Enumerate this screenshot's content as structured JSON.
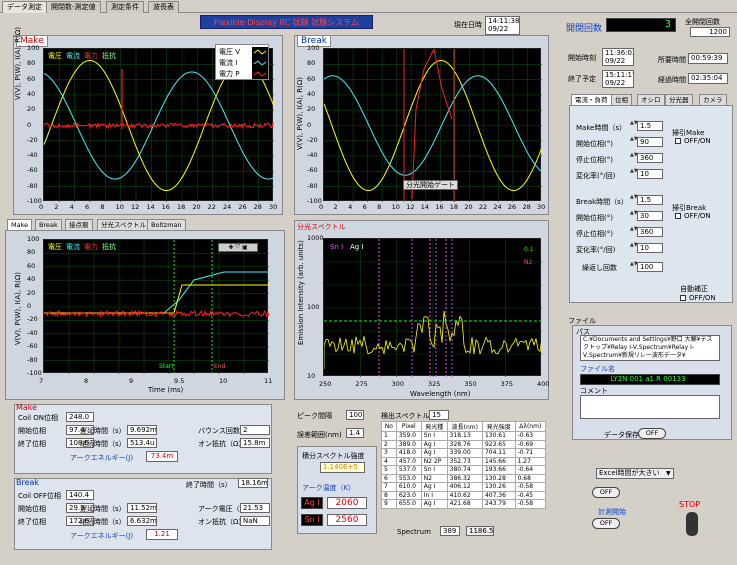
{
  "tabs": [
    "データ測定",
    "開閉数-測定値",
    "測定条件",
    "波長表"
  ],
  "app_title": "Flexible Display RC 試験 試験システム",
  "clock": {
    "label": "現在日時",
    "time": "14:11:38",
    "date": "09/22"
  },
  "counter": {
    "label": "開閉回数",
    "value": "3",
    "total_label": "全開閉回数",
    "total": "1200"
  },
  "times": [
    {
      "label": "開始時刻",
      "time": "11:36:03",
      "date": "09/22"
    },
    {
      "label": "終了予定",
      "time": "15:11:17",
      "date": "09/22"
    }
  ],
  "durations": [
    {
      "label": "所要時間",
      "value": "00:59:39"
    },
    {
      "label": "経過時間",
      "value": "02:35:04"
    }
  ],
  "right_tabs": [
    "電流・負荷",
    "位相",
    "オシロ",
    "分光器",
    "カメラ"
  ],
  "make_params": [
    {
      "label": "Make時間（s）",
      "value": "1.5"
    },
    {
      "label": "開始位相(°)",
      "value": "90"
    },
    {
      "label": "停止位相(°)",
      "value": "360"
    },
    {
      "label": "変化率(°/回)",
      "value": "10"
    }
  ],
  "make_cb": {
    "title": "掃引Make",
    "label": "OFF/ON"
  },
  "break_params": [
    {
      "label": "Break時間（s）",
      "value": "1.5"
    },
    {
      "label": "開始位相(°)",
      "value": "30"
    },
    {
      "label": "停止位相(°)",
      "value": "360"
    },
    {
      "label": "変化率(°/回)",
      "value": "10"
    }
  ],
  "break_cb": {
    "title": "掃引Break",
    "label": "OFF/ON"
  },
  "repeat": {
    "label": "繰返し回数",
    "value": "100"
  },
  "auto": {
    "title": "自動補正",
    "label": "OFF/ON"
  },
  "file": {
    "section": "ファイル",
    "path_label": "パス",
    "path": "C:¥Documents and Settings¥野口 大輔¥デスクトップ¥Relay I-V,Spectrum¥Relay I-V,Spectrum¥新規リレー波形データ¥",
    "name_label": "ファイル名",
    "name": "LY2N 001 a1 R 00133",
    "comment_label": "コメント",
    "comment": "",
    "save_label": "データ保存",
    "save_toggle": "OFF"
  },
  "excel": {
    "select": "Excel時間が大きい",
    "toggle1": "OFF",
    "meas_label": "計測開始",
    "toggle2": "OFF",
    "stop": "STOP"
  },
  "make_plot": {
    "title": "Make",
    "legend": [
      "電圧 V",
      "電流 I",
      "電力 P"
    ],
    "hdr": [
      "電圧",
      "電流",
      "電力",
      "抵抗"
    ],
    "ylabel": "V(V), P(W), I(A), R(Ω)",
    "yticks": [
      "100",
      "80",
      "60",
      "40",
      "20",
      "0",
      "-20",
      "-40",
      "-60",
      "-80",
      "-100"
    ],
    "xticks": [
      "0",
      "2",
      "4",
      "6",
      "8",
      "10",
      "12",
      "14",
      "16",
      "18",
      "20",
      "22",
      "24",
      "26",
      "28",
      "30"
    ]
  },
  "break_plot": {
    "title": "Break",
    "ylabel": "V(V), P(W), I(A), R(Ω)",
    "yticks": [
      "100",
      "80",
      "60",
      "40",
      "20",
      "0",
      "-20",
      "-40",
      "-60",
      "-80",
      "-100"
    ],
    "xticks": [
      "0",
      "2",
      "4",
      "6",
      "8",
      "10",
      "12",
      "14",
      "16",
      "18",
      "20",
      "22",
      "24",
      "26",
      "28",
      "30"
    ],
    "note": "分光開始ゲート"
  },
  "lower_tabs": [
    "Make",
    "Break",
    "接点痕",
    "分光スペクトル",
    "Boltzman"
  ],
  "zoom_plot": {
    "hdr": [
      "電圧",
      "電流",
      "電力",
      "抵抗"
    ],
    "ylabel": "V(V), P(W), I(A), R(Ω)",
    "xlabel": "Time (ms)",
    "yticks": [
      "100",
      "80",
      "60",
      "40",
      "20",
      "0",
      "-20",
      "-40",
      "-60",
      "-80",
      "-100"
    ],
    "xticks": [
      "7",
      "8",
      "9",
      "9.5",
      "10",
      "11"
    ],
    "start": "Start",
    "end": "End"
  },
  "spectrum": {
    "title": "分光スペクトル",
    "legend": [
      "Sn I",
      "Ag I"
    ],
    "ch": [
      "0.1",
      "N2"
    ],
    "ylabel": "Emission Intensity (arb. units)",
    "xlabel": "Wavelength (nm)",
    "yticks": [
      "1000",
      "100",
      "10"
    ],
    "xticks": [
      "250",
      "275",
      "300",
      "325",
      "350",
      "375",
      "400"
    ]
  },
  "make_results": {
    "title": "Make",
    "rows": [
      {
        "label": "Coil ON位相",
        "value": "248.0"
      },
      {
        "label": "開始位相",
        "value": "97.4"
      },
      {
        "label": "終了位相",
        "value": "108.5"
      },
      {
        "label": "遅延時間（s）",
        "value": "9.692m"
      },
      {
        "label": "継続時間（s）",
        "value": "513.4u"
      },
      {
        "label": "バウンス回数",
        "value": "2"
      },
      {
        "label": "オン抵抗（Ω）",
        "value": "15.8m"
      }
    ],
    "energy_label": "アークエネルギー(J)",
    "energy": "73.4m"
  },
  "break_results": {
    "title": "Break",
    "end_time_label": "終了時間（s）",
    "end_time": "18.16m",
    "rows": [
      {
        "label": "Coil OFF位相",
        "value": "140.4"
      },
      {
        "label": "開始位相",
        "value": "29.3"
      },
      {
        "label": "終了位相",
        "value": "172.6"
      },
      {
        "label": "遅延時間（s）",
        "value": "11.52m"
      },
      {
        "label": "継続時間（s）",
        "value": "6.632m"
      },
      {
        "label": "アーク電圧（V）",
        "value": "21.53"
      },
      {
        "label": "オン抵抗（Ω）",
        "value": "NaN"
      }
    ],
    "energy_label": "アークエネルギー(J)",
    "energy": "1.21"
  },
  "peak": {
    "interval_label": "ピーク間隔",
    "interval": "100",
    "width_label": "誤差範囲(nm)",
    "width": "1.4"
  },
  "integ": {
    "label": "積分スペクトル強度",
    "value": "1.140E+5",
    "temp_label": "アーク温度（K）",
    "temps": [
      {
        "name": "Ag I",
        "value": "2060"
      },
      {
        "name": "Sn I",
        "value": "2560"
      }
    ]
  },
  "detect": {
    "label": "検出スペクトル",
    "count": "15",
    "cols": [
      "No",
      "Pixel",
      "発光種",
      "波長(nm)",
      "発光強度",
      "Δλ(nm)"
    ],
    "rows": [
      [
        "1",
        "359.0",
        "Sn I",
        "318.13",
        "130.61",
        "-0.63"
      ],
      [
        "2",
        "389.0",
        "Ag I",
        "328.76",
        "923.65",
        "-0.69"
      ],
      [
        "3",
        "418.0",
        "Ag I",
        "339.00",
        "704.11",
        "-0.71"
      ],
      [
        "4",
        "457.0",
        "N2 2P",
        "352.73",
        "145.66",
        "1.27"
      ],
      [
        "5",
        "537.0",
        "Sn I",
        "380.74",
        "193.66",
        "-0.64"
      ],
      [
        "6",
        "553.0",
        "N2",
        "386.32",
        "130.28",
        "0.68"
      ],
      [
        "7",
        "610.0",
        "Ag I",
        "406.12",
        "130.26",
        "-0.58"
      ],
      [
        "8",
        "623.0",
        "In I",
        "410.62",
        "407.36",
        "-0.45"
      ],
      [
        "9",
        "655.0",
        "Ag I",
        "421.68",
        "243.79",
        "-0.58"
      ]
    ]
  },
  "spectrum_footer": {
    "label": "Spectrum",
    "value": "389",
    "readout": "1186.58"
  }
}
